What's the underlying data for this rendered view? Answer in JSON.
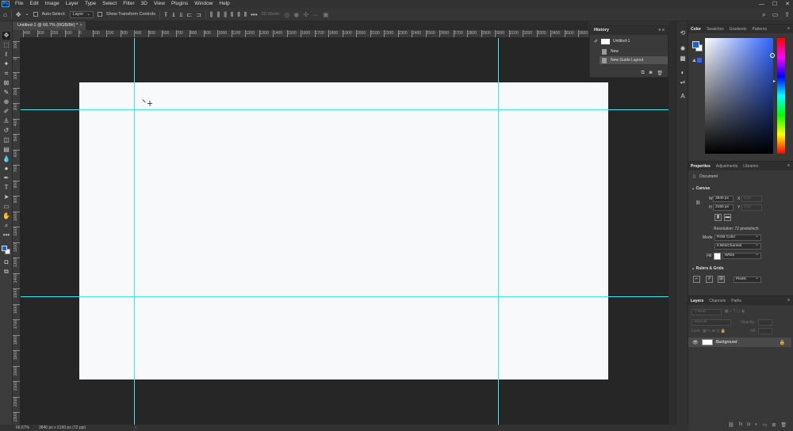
{
  "menubar": {
    "app_icon": "Ps",
    "items": [
      "File",
      "Edit",
      "Image",
      "Layer",
      "Type",
      "Select",
      "Filter",
      "3D",
      "View",
      "Plugins",
      "Window",
      "Help"
    ],
    "window_controls": [
      "—",
      "☐",
      "✕"
    ]
  },
  "options_bar": {
    "auto_select_label": "Auto-Select:",
    "auto_select_target": "Layer",
    "show_transform_label": "Show Transform Controls",
    "mode_3d_label": "3D Mode:"
  },
  "document_tab": {
    "title": "Untitled-1 @ 66.7% (RGB/8#) *",
    "close": "×"
  },
  "rulers": {
    "top_labels": [
      "400",
      "300",
      "200",
      "100",
      "0",
      "100",
      "200",
      "300",
      "400",
      "500",
      "600",
      "700",
      "800",
      "900",
      "1000",
      "1100",
      "1200",
      "1300",
      "1400",
      "1500",
      "1600",
      "1700",
      "1800",
      "1900",
      "2000",
      "2100",
      "2200",
      "2300",
      "2400",
      "2500",
      "2600",
      "2700",
      "2800",
      "2900",
      "3000",
      "3100",
      "3200",
      "3300",
      "3400",
      "3500",
      "3600",
      "3700",
      "3800",
      "3900",
      "4000",
      "4100"
    ],
    "left_labels": [
      "100",
      "0",
      "100",
      "200",
      "300",
      "400",
      "500",
      "600",
      "700",
      "800",
      "900",
      "1000",
      "1100",
      "1200",
      "1300",
      "1400",
      "1500",
      "1600",
      "1700",
      "1800",
      "1900",
      "2000",
      "2100",
      "2200",
      "2300"
    ]
  },
  "status_bar": {
    "zoom": "66.67%",
    "doc_info": "3840 px x 2160 px (72 ppi)",
    "arrow": "›"
  },
  "history": {
    "title": "History",
    "collapse": "»",
    "menu": "≡",
    "snapshot": "Untitled-1",
    "entries": [
      {
        "label": "New",
        "selected": false
      },
      {
        "label": "New Guide Layout",
        "selected": true
      }
    ]
  },
  "color_panel": {
    "tabs": [
      "Color",
      "Swatches",
      "Gradients",
      "Patterns"
    ],
    "foreground": "#1e5cd6",
    "background": "#ffffff",
    "hue_color": "#2f63ff"
  },
  "properties": {
    "tabs": [
      "Properties",
      "Adjustments",
      "Libraries"
    ],
    "document_label": "Document",
    "canvas_section": "Canvas",
    "w_label": "W",
    "w_value": "3840 px",
    "h_label": "H",
    "h_value": "2160 px",
    "x_label": "X",
    "x_value": "0 px",
    "y_label": "Y",
    "y_value": "0 px",
    "resolution": "Resolution: 72 pixels/inch",
    "mode_label": "Mode",
    "mode_value": "RGB Color",
    "bit_depth": "8 Bits/Channel",
    "fill_label": "Fill",
    "fill_value": "White",
    "rulers_section": "Rulers & Grids",
    "units_value": "Pixels"
  },
  "layers": {
    "tabs": [
      "Layers",
      "Channels",
      "Paths"
    ],
    "kind_placeholder": "Kind",
    "blend_mode": "Normal",
    "opacity_label": "Opacity:",
    "lock_label": "Lock:",
    "fill_label": "Fill:",
    "layer_name": "Background"
  },
  "colors": {
    "guide": "#46e6e8",
    "canvas": "#f8f9fa",
    "pasteboard": "#262626",
    "accent": "#31a8ff"
  }
}
